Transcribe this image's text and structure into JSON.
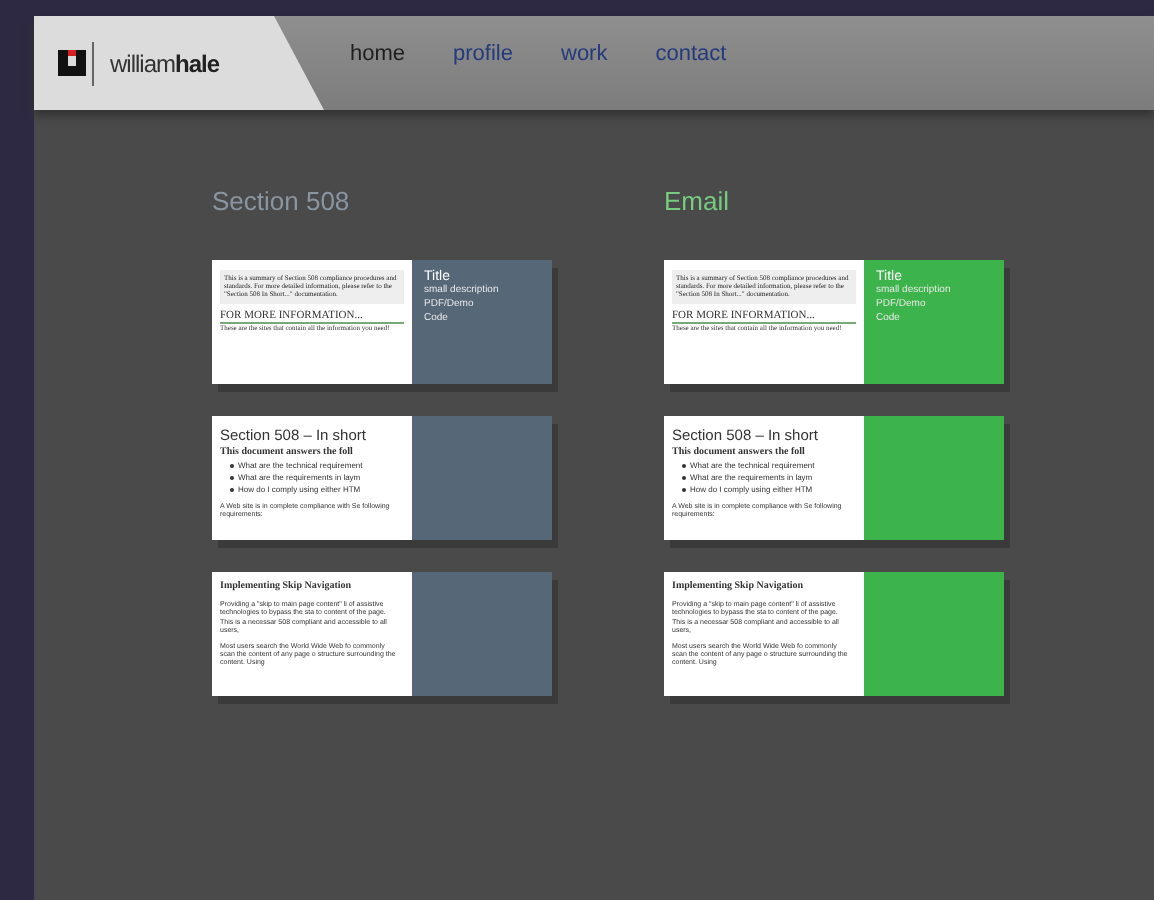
{
  "logo": {
    "name_light": "william",
    "name_bold": "hale"
  },
  "nav": [
    {
      "label": "home",
      "selected": true
    },
    {
      "label": "profile",
      "selected": false
    },
    {
      "label": "work",
      "selected": false
    },
    {
      "label": "contact",
      "selected": false
    }
  ],
  "sections": [
    {
      "title": "Section 508",
      "color": "#566878",
      "cards": [
        {
          "kind": "summary",
          "summary": "This is a summary of Section 508 compliance procedures and standards. For more detailed information, please refer to the \"Section 508 In Short...\" documentation.",
          "link": "FOR MORE INFORMATION...",
          "note": "These are the sites that contain all the information you need!",
          "panel": [
            "Title",
            "small description",
            "PDF/Demo",
            "Code"
          ]
        },
        {
          "kind": "short",
          "heading": "Section 508 – In short",
          "subheading": "This document answers the foll",
          "bullets": [
            "What are the technical requirement",
            "What are the requirements in laym",
            "How do I comply using either HTM"
          ],
          "paragraph": "A Web site is in complete compliance with Se following requirements:"
        },
        {
          "kind": "article",
          "heading": "Implementing Skip Navigation",
          "paragraphs": [
            "Providing a \"skip to main page content\" li of assistive technologies to bypass the sta to content of the page. This is a necessar 508 compliant and accessible to all users,",
            "Most users search the World Wide Web fo commonly scan the content of any page o structure surrounding the content. Using"
          ]
        }
      ]
    },
    {
      "title": "Email",
      "color": "#3cb44b",
      "cards": [
        {
          "kind": "summary",
          "summary": "This is a summary of Section 508 compliance procedures and standards. For more detailed information, please refer to the \"Section 508 In Short...\" documentation.",
          "link": "FOR MORE INFORMATION...",
          "note": "These are the sites that contain all the information you need!",
          "panel": [
            "Title",
            "small description",
            "PDF/Demo",
            "Code"
          ]
        },
        {
          "kind": "short",
          "heading": "Section 508 – In short",
          "subheading": "This document answers the foll",
          "bullets": [
            "What are the technical requirement",
            "What are the requirements in laym",
            "How do I comply using either HTM"
          ],
          "paragraph": "A Web site is in complete compliance with Se following requirements:"
        },
        {
          "kind": "article",
          "heading": "Implementing Skip Navigation",
          "paragraphs": [
            "Providing a \"skip to main page content\" li of assistive technologies to bypass the sta to content of the page. This is a necessar 508 compliant and accessible to all users,",
            "Most users search the World Wide Web fo commonly scan the content of any page o structure surrounding the content. Using"
          ]
        }
      ]
    }
  ]
}
